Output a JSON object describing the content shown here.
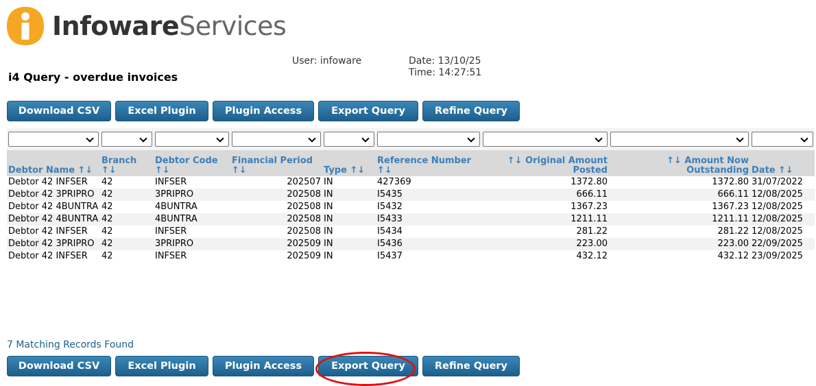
{
  "brand": {
    "name_bold": "Infoware",
    "name_light": "Services",
    "accent": "#f5a623"
  },
  "page": {
    "title": "i4 Query - overdue invoices",
    "user": "User: infoware",
    "date": "Date: 13/10/25",
    "time": "Time: 14:27:51",
    "record_count": "7 Matching Records Found"
  },
  "buttons": {
    "download_csv": "Download CSV",
    "excel_plugin": "Excel Plugin",
    "plugin_access": "Plugin Access",
    "export_query": "Export Query",
    "refine_query": "Refine Query"
  },
  "columns": [
    {
      "label": "Debtor Name ↑↓"
    },
    {
      "label": "Branch ↑↓"
    },
    {
      "label": "Debtor Code ↑↓"
    },
    {
      "label": "Financial Period ↑↓"
    },
    {
      "label": "Type ↑↓"
    },
    {
      "label": "Reference Number ↑↓"
    },
    {
      "label": "↑↓ Original Amount Posted"
    },
    {
      "label": "↑↓ Amount Now Outstanding"
    },
    {
      "label": "Date ↑↓"
    }
  ],
  "rows": [
    [
      "Debtor 42 INFSER",
      "42",
      "INFSER",
      "202507",
      "IN",
      "427369",
      "1372.80",
      "1372.80",
      "31/07/2022"
    ],
    [
      "Debtor 42 3PRIPRO",
      "42",
      "3PRIPRO",
      "202508",
      "IN",
      "I5435",
      "666.11",
      "666.11",
      "12/08/2025"
    ],
    [
      "Debtor 42 4BUNTRA",
      "42",
      "4BUNTRA",
      "202508",
      "IN",
      "I5432",
      "1367.23",
      "1367.23",
      "12/08/2025"
    ],
    [
      "Debtor 42 4BUNTRA",
      "42",
      "4BUNTRA",
      "202508",
      "IN",
      "I5433",
      "1211.11",
      "1211.11",
      "12/08/2025"
    ],
    [
      "Debtor 42 INFSER",
      "42",
      "INFSER",
      "202508",
      "IN",
      "I5434",
      "281.22",
      "281.22",
      "12/08/2025"
    ],
    [
      "Debtor 42 3PRIPRO",
      "42",
      "3PRIPRO",
      "202509",
      "IN",
      "I5436",
      "223.00",
      "223.00",
      "22/09/2025"
    ],
    [
      "Debtor 42 INFSER",
      "42",
      "INFSER",
      "202509",
      "IN",
      "I5437",
      "432.12",
      "432.12",
      "23/09/2025"
    ]
  ],
  "colors": {
    "button": "#2a72a4",
    "header_text": "#3c7fb8",
    "highlight_ring": "#e01010"
  }
}
